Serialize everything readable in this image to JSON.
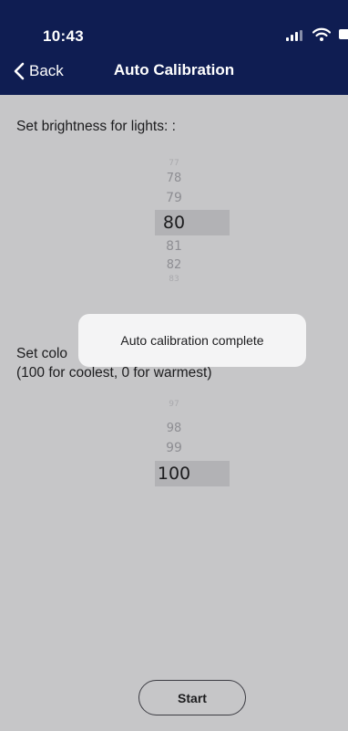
{
  "status_bar": {
    "time": "10:43"
  },
  "nav": {
    "back_label": "Back",
    "title": "Auto Calibration"
  },
  "brightness": {
    "label": "Set brightness for lights: :",
    "picker_above": [
      "77",
      "78",
      "79"
    ],
    "selected": "80",
    "picker_below": [
      "81",
      "82",
      "83"
    ]
  },
  "color_temp": {
    "label_line1": "Set colo",
    "label_line2": "(100 for coolest, 0 for warmest)",
    "picker_above": [
      "97",
      "98",
      "99"
    ],
    "selected": "100"
  },
  "toast": {
    "message": "Auto calibration complete"
  },
  "actions": {
    "start_label": "Start"
  },
  "colors": {
    "nav_background": "#0f1d52",
    "screen_background": "#c6c6c8",
    "selected_band": "#b2b2b5",
    "toast_background": "#f4f4f5"
  }
}
